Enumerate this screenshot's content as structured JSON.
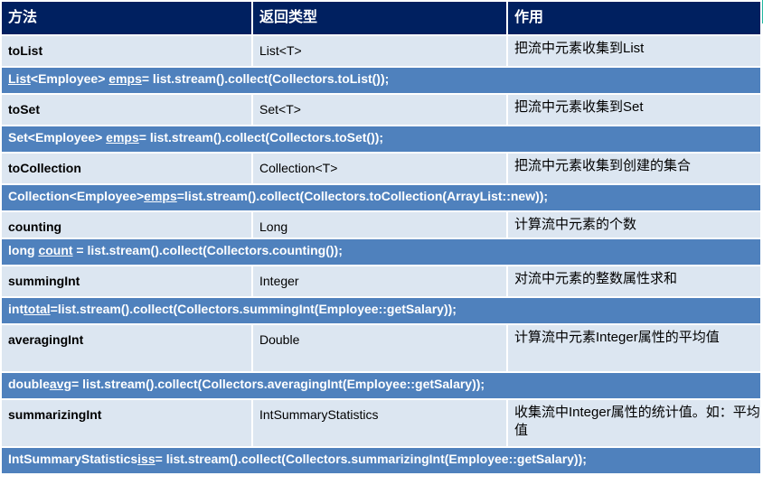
{
  "colors": {
    "header_bg": "#002060",
    "row_bg": "#dce6f1",
    "code_row_bg": "#4f81bd",
    "accent": "#20b8a0"
  },
  "table": {
    "headers": [
      "方法",
      "返回类型",
      "作用"
    ],
    "rows": [
      {
        "method": "toList",
        "return_type": "List<T>",
        "description": "把流中元素收集到List",
        "code": {
          "pre": "",
          "underlined_1": "List",
          "mid": "<Employee> ",
          "underlined_2": "emps",
          "post": "= list.stream().collect(Collectors.toList());"
        }
      },
      {
        "method": "toSet",
        "return_type": "Set<T>",
        "description": "把流中元素收集到Set",
        "code": {
          "pre": "Set<Employee> ",
          "underlined_1": "emps",
          "post": "= list.stream().collect(Collectors.toSet());"
        }
      },
      {
        "method": "toCollection",
        "return_type": "Collection<T>",
        "description": "把流中元素收集到创建的集合",
        "code": {
          "pre": "Collection<Employee>",
          "underlined_1": "emps",
          "post": "=list.stream().collect(Collectors.toCollection(ArrayList::new));"
        }
      },
      {
        "method": "counting",
        "return_type": "Long",
        "description": "计算流中元素的个数",
        "code": {
          "pre": "long ",
          "underlined_1": "count",
          "post": " = list.stream().collect(Collectors.counting());"
        }
      },
      {
        "method": "summingInt",
        "return_type": "Integer",
        "description": "对流中元素的整数属性求和",
        "code": {
          "pre": "int",
          "underlined_1": "total",
          "post": "=list.stream().collect(Collectors.summingInt(Employee::getSalary));"
        }
      },
      {
        "method": "averagingInt",
        "return_type": "Double",
        "description": "计算流中元素Integer属性的平均值",
        "code": {
          "pre": "double",
          "underlined_1": "avg",
          "post": "= list.stream().collect(Collectors.averagingInt(Employee::getSalary));"
        }
      },
      {
        "method": "summarizingInt",
        "return_type": "IntSummaryStatistics",
        "description": "收集流中Integer属性的统计值。如：平均值",
        "code": {
          "pre": "IntSummaryStatistics",
          "underlined_1": "iss",
          "post": "= list.stream().collect(Collectors.summarizingInt(Employee::getSalary));"
        }
      }
    ]
  }
}
